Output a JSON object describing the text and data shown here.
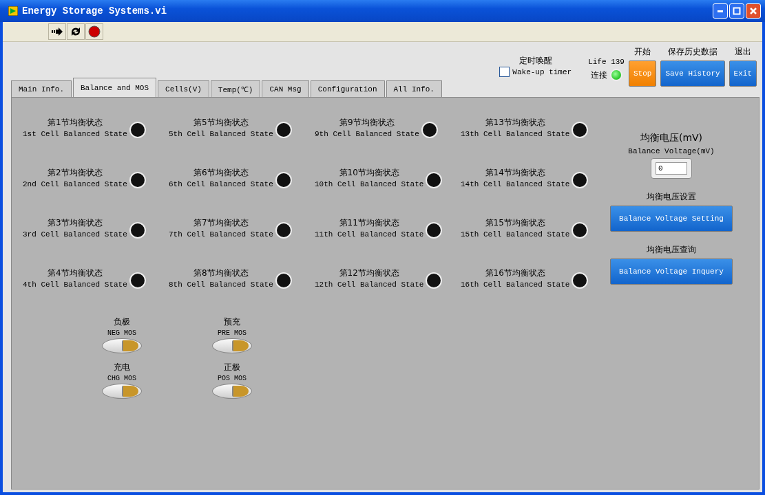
{
  "window": {
    "title": "Energy Storage Systems.vi"
  },
  "tabs": [
    {
      "label": "Main Info.",
      "selected": false
    },
    {
      "label": "Balance and MOS",
      "selected": true
    },
    {
      "label": "Cells(V)",
      "selected": false
    },
    {
      "label": "Temp(℃)",
      "selected": false
    },
    {
      "label": "CAN Msg",
      "selected": false
    },
    {
      "label": "Configuration",
      "selected": false
    },
    {
      "label": "All Info.",
      "selected": false
    }
  ],
  "wake_timer": {
    "title": "定时唤醒",
    "label": "Wake-up timer",
    "checked": false
  },
  "life": {
    "label": "Life 139",
    "connect_label": "连接",
    "connected": true
  },
  "buttons": [
    {
      "caption": "开始",
      "label": "Stop",
      "kind": "orange"
    },
    {
      "caption": "保存历史数据",
      "label": "Save History",
      "kind": "blue"
    },
    {
      "caption": "退出",
      "label": "Exit",
      "kind": "blue"
    }
  ],
  "balance_columns": [
    [
      {
        "cn": "第1节均衡状态",
        "en": "1st Cell Balanced State",
        "on": false
      },
      {
        "cn": "第2节均衡状态",
        "en": "2nd Cell Balanced State",
        "on": false
      },
      {
        "cn": "第3节均衡状态",
        "en": "3rd Cell Balanced State",
        "on": false
      },
      {
        "cn": "第4节均衡状态",
        "en": "4th Cell Balanced State",
        "on": false
      }
    ],
    [
      {
        "cn": "第5节均衡状态",
        "en": "5th Cell Balanced State",
        "on": false
      },
      {
        "cn": "第6节均衡状态",
        "en": "6th Cell Balanced State",
        "on": false
      },
      {
        "cn": "第7节均衡状态",
        "en": "7th Cell Balanced State",
        "on": false
      },
      {
        "cn": "第8节均衡状态",
        "en": "8th Cell Balanced State",
        "on": false
      }
    ],
    [
      {
        "cn": "第9节均衡状态",
        "en": "9th Cell Balanced State",
        "on": false
      },
      {
        "cn": "第10节均衡状态",
        "en": "10th Cell Balanced State",
        "on": false
      },
      {
        "cn": "第11节均衡状态",
        "en": "11th Cell Balanced State",
        "on": false
      },
      {
        "cn": "第12节均衡状态",
        "en": "12th Cell Balanced State",
        "on": false
      }
    ],
    [
      {
        "cn": "第13节均衡状态",
        "en": "13th Cell Balanced State",
        "on": false
      },
      {
        "cn": "第14节均衡状态",
        "en": "14th Cell Balanced State",
        "on": false
      },
      {
        "cn": "第15节均衡状态",
        "en": "15th Cell Balanced State",
        "on": false
      },
      {
        "cn": "第16节均衡状态",
        "en": "16th Cell Balanced State",
        "on": false
      }
    ]
  ],
  "balance_voltage": {
    "cn": "均衡电压(mV)",
    "en": "Balance Voltage(mV)",
    "value": "0",
    "setting_caption": "均衡电压设置",
    "setting_button": "Balance Voltage Setting",
    "inquiry_caption": "均衡电压查询",
    "inquiry_button": "Balance Voltage Inquery"
  },
  "mos": [
    {
      "cn": "负极",
      "en": "NEG MOS",
      "on": false
    },
    {
      "cn": "预充",
      "en": "PRE MOS",
      "on": false
    },
    {
      "cn": "充电",
      "en": "CHG MOS",
      "on": false
    },
    {
      "cn": "正极",
      "en": "POS MOS",
      "on": false
    }
  ]
}
